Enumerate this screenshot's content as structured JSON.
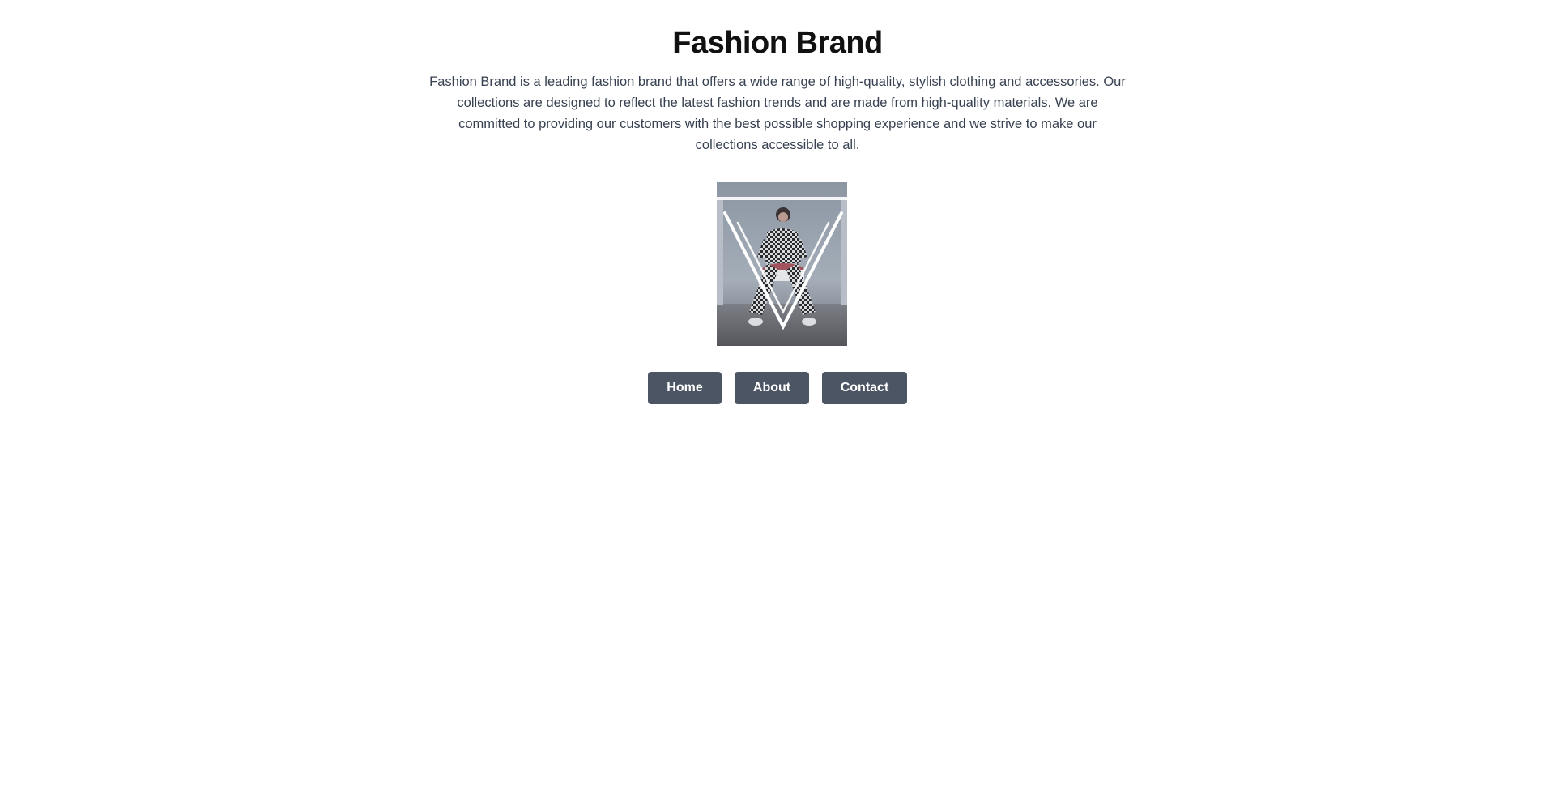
{
  "page": {
    "title": "Fashion Brand",
    "description": "Fashion Brand is a leading fashion brand that offers a wide range of high-quality, stylish clothing and accessories. Our collections are designed to reflect the latest fashion trends and are made from high-quality materials. We are committed to providing our customers with the best possible shopping experience and we strive to make our collections accessible to all."
  },
  "hero_image": {
    "subject": "model in checkered suit seated inside neon V light installation"
  },
  "nav": {
    "home_label": "Home",
    "about_label": "About",
    "contact_label": "Contact"
  },
  "colors": {
    "button_bg": "#4b5563",
    "button_text": "#ffffff",
    "title_text": "#111111",
    "body_text": "#374151"
  }
}
